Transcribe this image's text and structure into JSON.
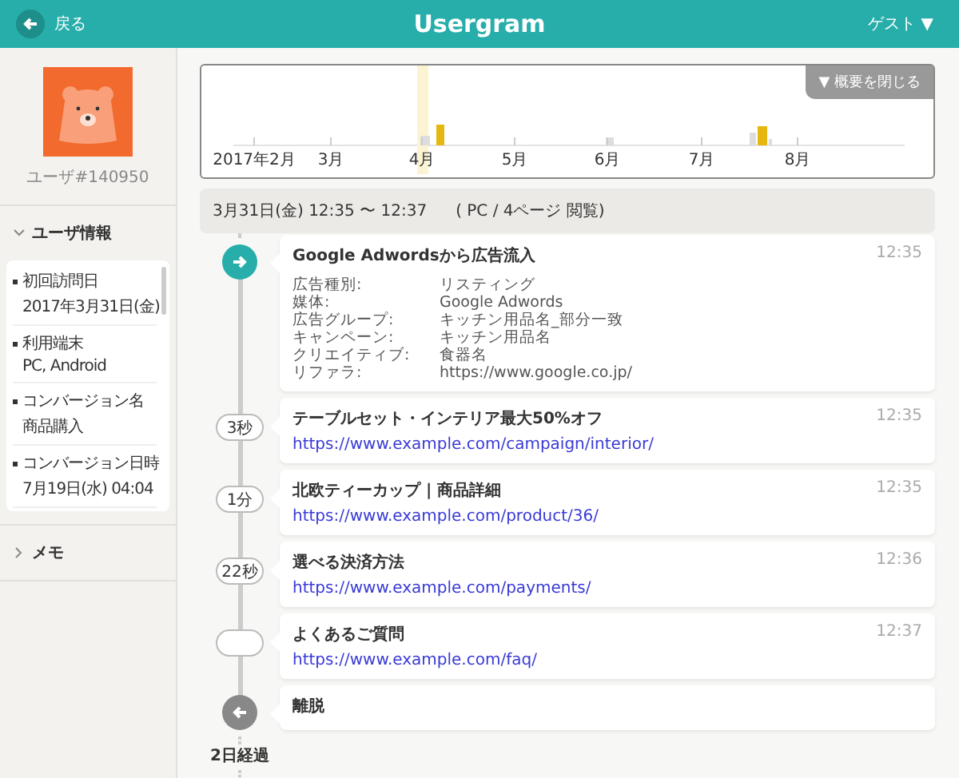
{
  "header": {
    "back_label": "戻る",
    "title": "Usergram",
    "user_menu": "ゲスト ▼"
  },
  "sidebar": {
    "user_id": "ユーザ#140950",
    "sections": [
      {
        "label": "ユーザ情報",
        "expanded": true,
        "items": [
          {
            "label": "初回訪問日",
            "value": "2017年3月31日(金)"
          },
          {
            "label": "利用端末",
            "value": "PC, Android"
          },
          {
            "label": "コンバージョン名",
            "value": "商品購入"
          },
          {
            "label": "コンバージョン日時",
            "value": "7月19日(水) 04:04"
          }
        ]
      },
      {
        "label": "メモ",
        "expanded": false
      }
    ]
  },
  "overview": {
    "close_button": "▼ 概要を閉じる",
    "months": [
      "2017年2月",
      "3月",
      "4月",
      "5月",
      "6月",
      "7月",
      "8月"
    ]
  },
  "session": {
    "date_range": "3月31日(金) 12:35 〜 12:37",
    "summary": "( PC / 4ページ 閲覧)"
  },
  "events": [
    {
      "kind": "entry",
      "title": "Google Adwordsから広告流入",
      "time": "12:35",
      "details": [
        {
          "label": "広告種別:",
          "value": "リスティング"
        },
        {
          "label": "媒体:",
          "value": "Google Adwords"
        },
        {
          "label": "広告グループ:",
          "value": "キッチン用品名_部分一致"
        },
        {
          "label": "キャンペーン:",
          "value": "キッチン用品名"
        },
        {
          "label": "クリエイティブ:",
          "value": "食器名"
        },
        {
          "label": "リファラ:",
          "value": "https://www.google.co.jp/"
        }
      ]
    },
    {
      "kind": "page",
      "gap": "3秒",
      "title": "テーブルセット・インテリア最大50%オフ",
      "time": "12:35",
      "url": "https://www.example.com/campaign/interior/"
    },
    {
      "kind": "page",
      "gap": "1分",
      "title": "北欧ティーカップ | 商品詳細",
      "time": "12:35",
      "url": "https://www.example.com/product/36/"
    },
    {
      "kind": "page",
      "gap": "22秒",
      "title": "選べる決済方法",
      "time": "12:36",
      "url": "https://www.example.com/payments/"
    },
    {
      "kind": "page",
      "title": "よくあるご質問",
      "time": "12:37",
      "url": "https://www.example.com/faq/"
    },
    {
      "kind": "exit",
      "title": "離脱"
    }
  ],
  "elapsed": "2日経過"
}
